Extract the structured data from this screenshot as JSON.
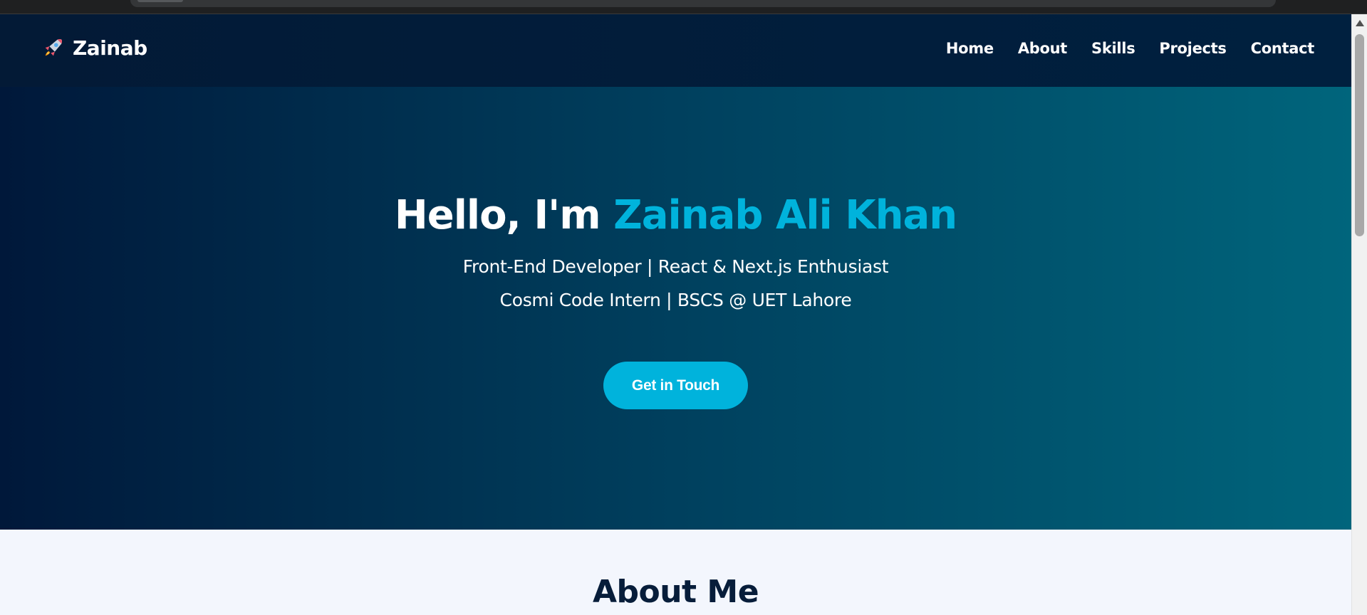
{
  "navbar": {
    "brand_icon": "rocket-icon",
    "brand_name": "Zainab",
    "links": [
      {
        "label": "Home"
      },
      {
        "label": "About"
      },
      {
        "label": "Skills"
      },
      {
        "label": "Projects"
      },
      {
        "label": "Contact"
      }
    ]
  },
  "hero": {
    "greeting": "Hello, I'm ",
    "name": "Zainab Ali Khan",
    "tagline": "Front-End Developer | React & Next.js Enthusiast",
    "subline": "Cosmi Code Intern | BSCS @ UET Lahore",
    "cta_label": "Get in Touch"
  },
  "about": {
    "title": "About Me"
  },
  "colors": {
    "accent": "#00b3dc",
    "navbar_bg": "#00203f",
    "hero_gradient_start": "#00183a",
    "hero_gradient_end": "#00657c",
    "about_bg": "#f3f6fd",
    "about_title": "#071d3a"
  }
}
